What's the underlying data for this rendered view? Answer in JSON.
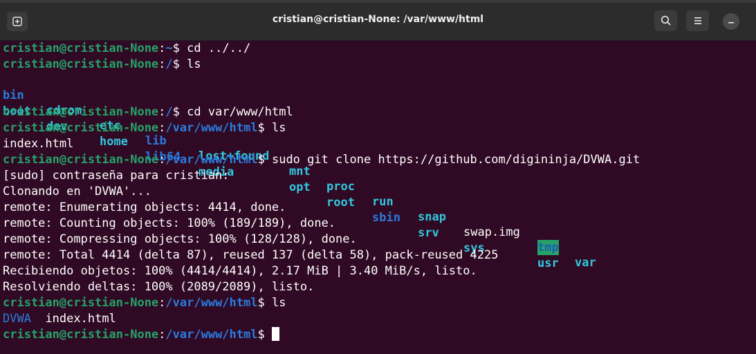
{
  "window": {
    "title": "cristian@cristian-None: /var/www/html"
  },
  "icons": {
    "new_tab": "new-tab-icon",
    "search": "search-icon",
    "menu": "hamburger-menu-icon",
    "minimize": "minimize-icon"
  },
  "colors": {
    "background": "#300a24",
    "prompt_user": "#26a269",
    "prompt_path": "#2a7bde",
    "text": "#ffffff",
    "highlight": "#26a269"
  },
  "prompt": {
    "userhost": "cristian@cristian-None",
    "colon": ":",
    "dollar": "$"
  },
  "lines": {
    "l1": {
      "path": "~",
      "cmd": " cd ../../"
    },
    "l2": {
      "path": "/",
      "cmd": " ls"
    },
    "l5": {
      "path": "/",
      "cmd": " cd var/www/html"
    },
    "l6": {
      "path": "/var/www/html",
      "cmd": " ls"
    },
    "l7": "index.html",
    "l8": {
      "path": "/var/www/html",
      "cmd": " sudo git clone https://github.com/digininja/DVWA.git"
    },
    "l9": "[sudo] contraseña para cristian:",
    "l10": "Clonando en 'DVWA'...",
    "l11": "remote: Enumerating objects: 4414, done.",
    "l12": "remote: Counting objects: 100% (189/189), done.",
    "l13": "remote: Compressing objects: 100% (128/128), done.",
    "l14": "remote: Total 4414 (delta 87), reused 137 (delta 58), pack-reused 4225",
    "l15": "Recibiendo objetos: 100% (4414/4414), 2.17 MiB | 3.40 MiB/s, listo.",
    "l16": "Resolviendo deltas: 100% (2089/2089), listo.",
    "l17": {
      "path": "/var/www/html",
      "cmd": " ls"
    },
    "l19": {
      "path": "/var/www/html",
      "cmd": " "
    }
  },
  "ls_root": {
    "row1": [
      "bin",
      "cdrom",
      "etc",
      "lib",
      "lost+found",
      "mnt",
      "proc",
      "run",
      "snap",
      "swap.img",
      "tmp",
      "var"
    ],
    "row2": [
      "boot",
      "dev",
      "home",
      "lib64",
      "media",
      "opt",
      "root",
      "sbin",
      "srv",
      "sys",
      "usr"
    ]
  },
  "ls_html": {
    "dir": "DVWA",
    "file": "index.html"
  }
}
